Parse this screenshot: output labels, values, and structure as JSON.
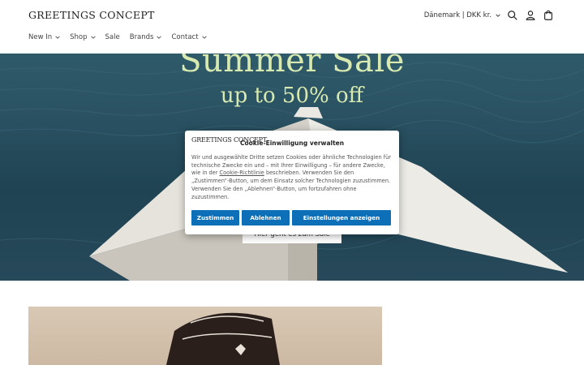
{
  "header": {
    "logo": "GREETINGS CONCEPT",
    "locale": "Dänemark | DKK kr.",
    "icons": [
      "search-icon",
      "account-icon",
      "cart-icon"
    ]
  },
  "nav": {
    "items": [
      {
        "label": "New In",
        "dropdown": true
      },
      {
        "label": "Shop",
        "dropdown": true
      },
      {
        "label": "Sale",
        "dropdown": false
      },
      {
        "label": "Brands",
        "dropdown": true
      },
      {
        "label": "Contact",
        "dropdown": true
      }
    ]
  },
  "hero": {
    "title": "Summer Sale",
    "subtitle": "up to 50% off",
    "button": "Hier geht es zum Sale",
    "text_color": "#d9eab0"
  },
  "cookie": {
    "logo": "GREETINGS CONCEPT",
    "title": "Cookie-Einwilligung verwalten",
    "text_before_link": "Wir und ausgewählte Dritte setzen Cookies oder ähnliche Technologien für technische Zwecke ein und – mit Ihrer Einwilligung – für andere Zwecke, wie in der ",
    "link": "Cookie-Richtlinie",
    "text_after_link": " beschrieben. Verwenden Sie den „Zustimmen“-Button, um dem Einsatz solcher Technologien zuzustimmen. Verwenden Sie den „Ablehnen“-Button, um fortzufahren ohne zuzustimmen.",
    "buttons": {
      "accept": "Zustimmen",
      "reject": "Ablehnen",
      "settings": "Einstellungen anzeigen"
    },
    "accent_color": "#0c6fb8"
  }
}
